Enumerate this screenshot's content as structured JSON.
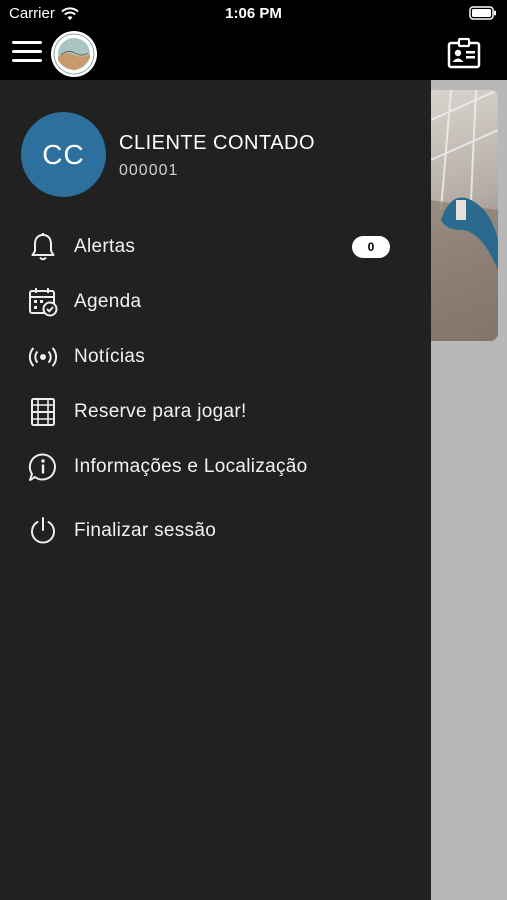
{
  "status_bar": {
    "carrier": "Carrier",
    "time": "1:06 PM"
  },
  "header": {
    "menu_icon": "hamburger-menu-icon",
    "logo_icon": "club-logo",
    "action_icon": "id-card-icon"
  },
  "user": {
    "initials": "CC",
    "name": "CLIENTE CONTADO",
    "code": "000001"
  },
  "menu": [
    {
      "label": "Alertas",
      "icon": "bell-icon",
      "badge": "0"
    },
    {
      "label": "Agenda",
      "icon": "calendar-check-icon"
    },
    {
      "label": "Notícias",
      "icon": "broadcast-icon"
    },
    {
      "label": "Reserve para jogar!",
      "icon": "court-icon"
    },
    {
      "label": "Informações e Localização",
      "icon": "info-chat-icon"
    },
    {
      "label": "Finalizar sessão",
      "icon": "power-icon"
    }
  ],
  "colors": {
    "avatar": "#2d6f9d",
    "drawer": "#212121",
    "header": "#000000"
  }
}
